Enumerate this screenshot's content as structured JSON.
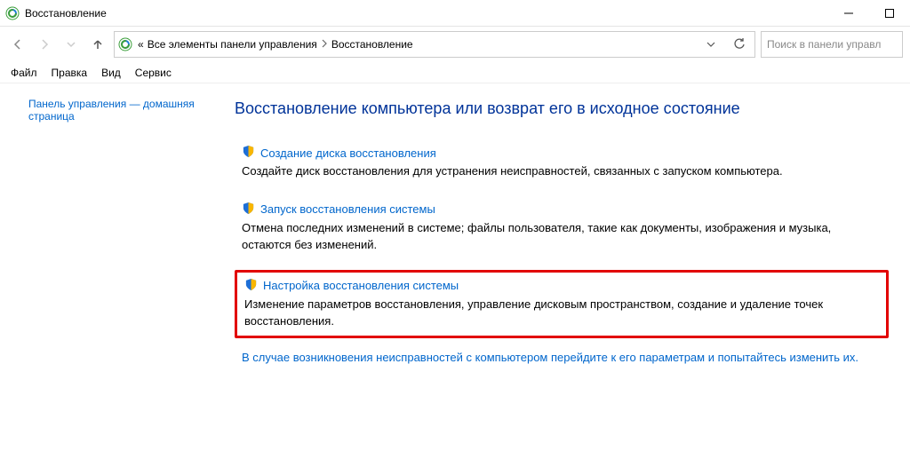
{
  "window": {
    "title": "Восстановление"
  },
  "address": {
    "c1": "«",
    "c2": "Все элементы панели управления",
    "c3": "Восстановление"
  },
  "search": {
    "placeholder": "Поиск в панели управл"
  },
  "menu": {
    "file": "Файл",
    "edit": "Правка",
    "view": "Вид",
    "tools": "Сервис"
  },
  "sidebar": {
    "home_link": "Панель управления — домашняя страница"
  },
  "content": {
    "heading": "Восстановление компьютера или возврат его в исходное состояние",
    "items": [
      {
        "title": "Создание диска восстановления",
        "desc": "Создайте диск восстановления для устранения неисправностей, связанных с запуском компьютера."
      },
      {
        "title": "Запуск восстановления системы",
        "desc": "Отмена последних изменений в системе; файлы пользователя, такие как документы, изображения и музыка, остаются без изменений."
      },
      {
        "title": "Настройка восстановления системы",
        "desc": "Изменение параметров восстановления, управление дисковым пространством, создание и удаление точек восстановления."
      }
    ],
    "footer": "В случае возникновения неисправностей с компьютером перейдите к его параметрам и попытайтесь изменить их."
  }
}
